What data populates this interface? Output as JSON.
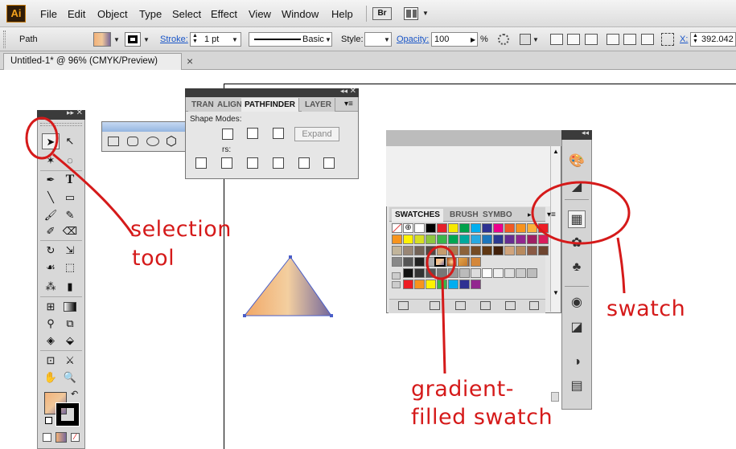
{
  "app": {
    "logo": "Ai",
    "menus": [
      "File",
      "Edit",
      "Object",
      "Type",
      "Select",
      "Effect",
      "View",
      "Window",
      "Help"
    ],
    "bridge_label": "Br"
  },
  "control_bar": {
    "selection_type": "Path",
    "stroke_label": "Stroke:",
    "stroke_value": "1 pt",
    "brush_style": "Basic",
    "style_label": "Style:",
    "opacity_label": "Opacity:",
    "opacity_value": "100",
    "opacity_unit": "%",
    "x_label": "X:",
    "x_value": "392.042"
  },
  "document": {
    "tab_title": "Untitled-1* @ 96% (CMYK/Preview)",
    "tab_close": "×"
  },
  "pathfinder_panel": {
    "tabs": [
      "TRAN",
      "ALIGN",
      "PATHFINDER",
      "LAYER"
    ],
    "active_tab": "PATHFINDER",
    "shape_modes_label": "Shape Modes:",
    "pathfinders_label": "rs:",
    "expand_label": "Expand"
  },
  "swatches_panel": {
    "tabs": [
      "SWATCHES",
      "BRUSH",
      "SYMBO"
    ],
    "active_tab": "SWATCHES",
    "rows": [
      [
        "#ffffff",
        "#ffffff",
        "#ffffff",
        "#000000",
        "#e5202a",
        "#f7e900",
        "#00a14b",
        "#00aeef",
        "#2e3192",
        "#ec008c",
        "#f15a24",
        "#f7931e",
        "#fbb03b",
        "#ed1c24"
      ],
      [
        "#f7941d",
        "#fff200",
        "#d7df23",
        "#8dc63f",
        "#39b54a",
        "#00a651",
        "#00a99d",
        "#27aae1",
        "#1c75bc",
        "#2b3990",
        "#662d91",
        "#92278f",
        "#9e1f63",
        "#da1c5c"
      ],
      [
        "#c2b59b",
        "#998675",
        "#736357",
        "#534741",
        "#c69c6d",
        "#a67c52",
        "#8c6239",
        "#754c24",
        "#603813",
        "#42210b",
        "#d1a47c",
        "#b88a5e",
        "#8a5a44",
        "#6e4530"
      ],
      [
        "#888888",
        "#555555",
        "#222222",
        "#b0b0b0",
        "#d0d0d0",
        "#eeeeee",
        "#a05a2c",
        "#d4873a"
      ],
      [
        "#111111",
        "#333333",
        "#555555",
        "#777777",
        "#999999",
        "#bbbbbb",
        "#dddddd",
        "#ffffff",
        "#f0f0f0",
        "#e0e0e0",
        "#cccccc",
        "#bcbcbc"
      ],
      [
        "#ed1c24",
        "#f7941d",
        "#fff200",
        "#39b54a",
        "#00aeef",
        "#2e3192",
        "#92278f"
      ]
    ]
  },
  "annotations": {
    "selection_tool_line1": "selection",
    "selection_tool_line2": "tool",
    "swatch": "swatch",
    "gradient_line1": "gradient-",
    "gradient_line2": "filled swatch"
  },
  "colors": {
    "annotation_red": "#d51a1a",
    "link_blue": "#1a56c8",
    "gradient_start": "#f2b27a",
    "gradient_mid": "#f0c79a",
    "gradient_end": "#7a6a9a"
  },
  "icons": {
    "tools": [
      "selection-arrow-icon",
      "direct-selection-icon",
      "pen-icon",
      "type-icon",
      "line-icon",
      "rectangle-icon",
      "paintbrush-icon",
      "pencil-icon",
      "blob-brush-icon",
      "eraser-icon",
      "rotate-icon",
      "scale-icon",
      "warp-icon",
      "free-transform-icon",
      "symbol-sprayer-icon",
      "graph-icon",
      "mesh-icon",
      "gradient-icon",
      "eyedropper-icon",
      "blend-icon",
      "live-paint-icon",
      "live-paint-select-icon",
      "artboard-icon",
      "slice-icon",
      "hand-icon",
      "zoom-icon"
    ]
  }
}
